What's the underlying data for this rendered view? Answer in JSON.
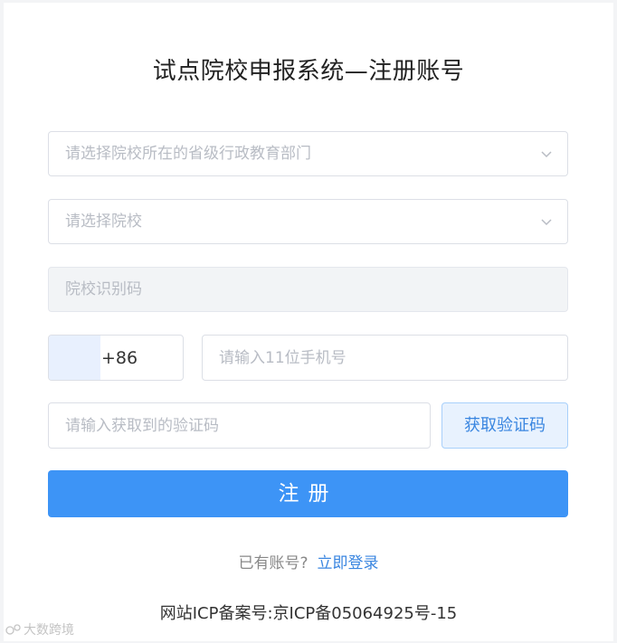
{
  "page": {
    "title": "试点院校申报系统—注册账号"
  },
  "form": {
    "province_select": {
      "placeholder": "请选择院校所在的省级行政教育部门"
    },
    "school_select": {
      "placeholder": "请选择院校"
    },
    "school_code": {
      "placeholder": "院校识别码"
    },
    "phone": {
      "country_code": "+86",
      "placeholder": "请输入11位手机号"
    },
    "verification": {
      "placeholder": "请输入获取到的验证码",
      "button_label": "获取验证码"
    },
    "register_button": "注册"
  },
  "login_prompt": {
    "question": "已有账号?",
    "link": "立即登录"
  },
  "footer": {
    "icp": "网站ICP备案号:京ICP备05064925号-15"
  },
  "watermark": {
    "text": "大数跨境"
  },
  "colors": {
    "primary": "#3d94f6",
    "link": "#3a86e0",
    "border": "#dcdfe6",
    "disabled_bg": "#f2f4f6"
  }
}
